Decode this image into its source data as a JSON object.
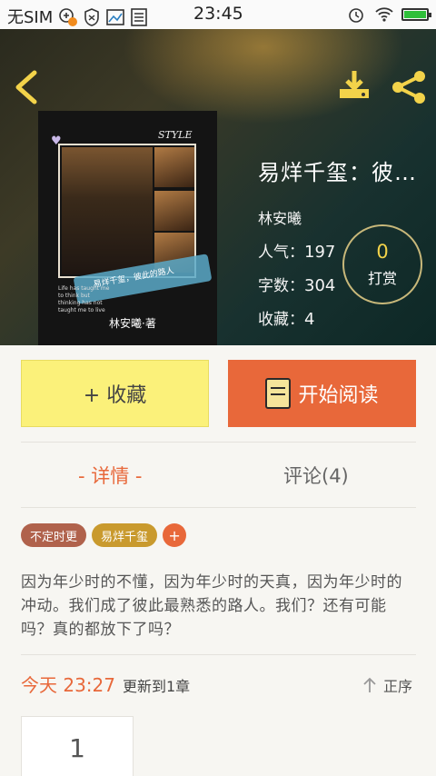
{
  "status_bar": {
    "carrier": "无SIM",
    "time": "23:45",
    "notification_badge": "1"
  },
  "header": {
    "icons": [
      "back-arrow-icon",
      "download-icon",
      "share-icon"
    ],
    "accent": "#f3d34a"
  },
  "cover": {
    "style_text": "STYLE",
    "swoosh_text": "易烊千玺，彼此的路人",
    "small_text": "Life has taught me to think but thinking has not taught me to live",
    "author_mark": "林安曦·著"
  },
  "book": {
    "title": "易烊千玺：彼…",
    "author": "林安曦",
    "popularity_label": "人气：",
    "popularity": "197",
    "words_label": "字数：",
    "words": "304",
    "favorites_label": "收藏：",
    "favorites": "4"
  },
  "reward": {
    "count": "0",
    "label": "打赏"
  },
  "actions": {
    "favorite_label": "+ 收藏",
    "read_label": "开始阅读"
  },
  "tabs": {
    "detail": "- 详情 -",
    "comments": "评论(4)"
  },
  "tags": {
    "items": [
      "不定时更",
      "易烊千玺"
    ],
    "add": "+"
  },
  "description": "因为年少时的不懂，因为年少时的天真，因为年少时的冲动。我们成了彼此最熟悉的路人。我们？还有可能吗？真的都放下了吗？",
  "update": {
    "when": "今天 23:27",
    "what": "更新到1章",
    "order": "正序"
  },
  "chapters": [
    "1"
  ],
  "colors": {
    "accent_orange": "#e8683a",
    "favorite_yellow": "#fbf17a"
  }
}
